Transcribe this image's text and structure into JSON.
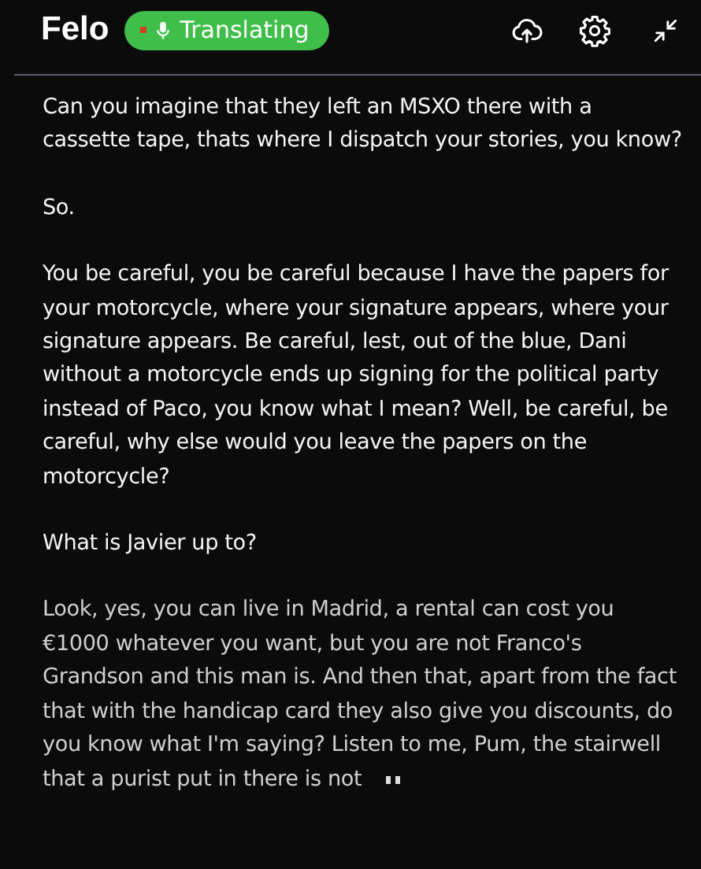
{
  "header": {
    "logo": "Felo",
    "status": {
      "label": "Translating",
      "recording": true
    }
  },
  "paragraphs": [
    {
      "text": "Can you imagine that they left an MSXO there with a cassette tape, thats where I dispatch your stories, you know?",
      "final": true
    },
    {
      "text": "So.",
      "final": true
    },
    {
      "text": "You be careful, you be careful because I have the papers for your motorcycle, where your signature appears, where your signature appears. Be careful, lest, out of the blue, Dani without a motorcycle ends up signing for the political party instead of Paco, you know what I mean? Well, be careful, be careful, why else would you leave the papers on the motorcycle?",
      "final": true
    },
    {
      "text": "What is Javier up to?",
      "final": true
    },
    {
      "text": "Look, yes, you can live in Madrid, a rental can cost you €1000 whatever you want, but you are not Franco's Grandson and this man is. And then that, apart from the fact that with the handicap card they also give you discounts, do you know what I'm saying? Listen to me, Pum, the stairwell that a purist put in there is not",
      "final": false
    }
  ]
}
